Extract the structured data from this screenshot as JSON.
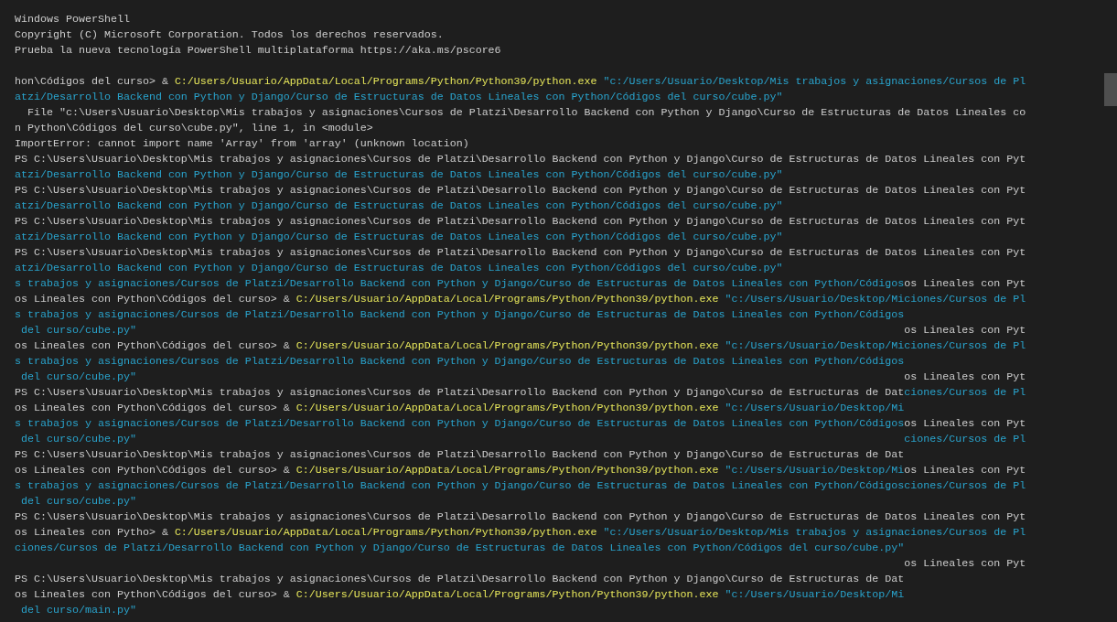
{
  "header": [
    "Windows PowerShell",
    "Copyright (C) Microsoft Corporation. Todos los derechos reservados.",
    "Prueba la nueva tecnología PowerShell multiplataforma https://aka.ms/pscore6"
  ],
  "output": [
    {
      "segments": [
        {
          "kind": "plain",
          "text": "hon\\Códigos del curso> & "
        },
        {
          "kind": "exe",
          "text": "C:/Users/Usuario/AppData/Local/Programs/Python/Python39/python.exe"
        },
        {
          "kind": "string",
          "text": " \"c:/Users/Usuario/Desktop/Mis trabajos y asignaciones/Cursos de Pl"
        }
      ]
    },
    {
      "segments": [
        {
          "kind": "string",
          "text": "atzi/Desarrollo Backend con Python y Django/Curso de Estructuras de Datos Lineales con Python/Códigos del curso/cube.py\""
        }
      ]
    },
    {
      "segments": [
        {
          "kind": "plain",
          "text": "  File \"c:\\Users\\Usuario\\Desktop\\Mis trabajos y asignaciones\\Cursos de Platzi\\Desarrollo Backend con Python y Django\\Curso de Estructuras de Datos Lineales co"
        }
      ]
    },
    {
      "segments": [
        {
          "kind": "plain",
          "text": "n Python\\Códigos del curso\\cube.py\", line 1, in <module>"
        }
      ]
    },
    {
      "segments": [
        {
          "kind": "plain",
          "text": "ImportError: cannot import name 'Array' from 'array' (unknown location)"
        }
      ]
    },
    {
      "segments": [
        {
          "kind": "plain",
          "text": "PS C:\\Users\\Usuario\\Desktop\\Mis trabajos y asignaciones\\Cursos de Platzi\\Desarrollo Backend con Python y Django\\Curso de Estructuras de Datos Lineales con Pyt"
        }
      ]
    },
    {
      "segments": [
        {
          "kind": "string",
          "text": "atzi/Desarrollo Backend con Python y Django/Curso de Estructuras de Datos Lineales con Python/Códigos del curso/cube.py\""
        }
      ]
    },
    {
      "segments": [
        {
          "kind": "plain",
          "text": "PS C:\\Users\\Usuario\\Desktop\\Mis trabajos y asignaciones\\Cursos de Platzi\\Desarrollo Backend con Python y Django\\Curso de Estructuras de Datos Lineales con Pyt"
        }
      ]
    },
    {
      "segments": [
        {
          "kind": "string",
          "text": "atzi/Desarrollo Backend con Python y Django/Curso de Estructuras de Datos Lineales con Python/Códigos del curso/cube.py\""
        }
      ]
    },
    {
      "segments": [
        {
          "kind": "plain",
          "text": "PS C:\\Users\\Usuario\\Desktop\\Mis trabajos y asignaciones\\Cursos de Platzi\\Desarrollo Backend con Python y Django\\Curso de Estructuras de Datos Lineales con Pyt"
        }
      ]
    },
    {
      "segments": [
        {
          "kind": "string",
          "text": "atzi/Desarrollo Backend con Python y Django/Curso de Estructuras de Datos Lineales con Python/Códigos del curso/cube.py\""
        }
      ]
    },
    {
      "segments": [
        {
          "kind": "plain",
          "text": "PS C:\\Users\\Usuario\\Desktop\\Mis trabajos y asignaciones\\Cursos de Platzi\\Desarrollo Backend con Python y Django\\Curso de Estructuras de Datos Lineales con Pyt"
        }
      ]
    },
    {
      "segments": [
        {
          "kind": "string",
          "text": "atzi/Desarrollo Backend con Python y Django/Curso de Estructuras de Datos Lineales con Python/Códigos del curso/cube.py\""
        }
      ]
    },
    {
      "segments": [
        {
          "kind": "string",
          "text": "s trabajos y asignaciones/Cursos de Platzi/Desarrollo Backend con Python y Django/Curso de Estructuras de Datos Lineales con Python/Códigos"
        },
        {
          "kind": "plain",
          "text": "os Lineales con Pyt"
        }
      ]
    },
    {
      "segments": [
        {
          "kind": "plain",
          "text": "os Lineales con Python\\Códigos del curso> & "
        },
        {
          "kind": "exe",
          "text": "C:/Users/Usuario/AppData/Local/Programs/Python/Python39/python.exe"
        },
        {
          "kind": "string",
          "text": " \"c:/Users/Usuario/Desktop/Miciones/Cursos de Pl"
        }
      ]
    },
    {
      "segments": [
        {
          "kind": "string",
          "text": "s trabajos y asignaciones/Cursos de Platzi/Desarrollo Backend con Python y Django/Curso de Estructuras de Datos Lineales con Python/Códigos"
        }
      ]
    },
    {
      "segments": [
        {
          "kind": "string",
          "text": " del curso/cube.py\""
        }
      ],
      "right": [
        {
          "kind": "plain",
          "text": "os Lineales con Pyt"
        }
      ]
    },
    {
      "segments": [
        {
          "kind": "plain",
          "text": "os Lineales con Python\\Códigos del curso> & "
        },
        {
          "kind": "exe",
          "text": "C:/Users/Usuario/AppData/Local/Programs/Python/Python39/python.exe"
        },
        {
          "kind": "string",
          "text": " \"c:/Users/Usuario/Desktop/Miciones/Cursos de Pl"
        }
      ]
    },
    {
      "segments": [
        {
          "kind": "string",
          "text": "s trabajos y asignaciones/Cursos de Platzi/Desarrollo Backend con Python y Django/Curso de Estructuras de Datos Lineales con Python/Códigos"
        }
      ]
    },
    {
      "segments": [
        {
          "kind": "string",
          "text": " del curso/cube.py\""
        }
      ],
      "right": [
        {
          "kind": "plain",
          "text": "os Lineales con Pyt"
        }
      ]
    },
    {
      "segments": [
        {
          "kind": "plain",
          "text": "PS C:\\Users\\Usuario\\Desktop\\Mis trabajos y asignaciones\\Cursos de Platzi\\Desarrollo Backend con Python y Django\\Curso de Estructuras de Dat"
        },
        {
          "kind": "string",
          "text": "ciones/Cursos de Pl"
        }
      ]
    },
    {
      "segments": [
        {
          "kind": "plain",
          "text": "os Lineales con Python\\Códigos del curso> & "
        },
        {
          "kind": "exe",
          "text": "C:/Users/Usuario/AppData/Local/Programs/Python/Python39/python.exe"
        },
        {
          "kind": "string",
          "text": " \"c:/Users/Usuario/Desktop/Mi"
        }
      ]
    },
    {
      "segments": [
        {
          "kind": "string",
          "text": "s trabajos y asignaciones/Cursos de Platzi/Desarrollo Backend con Python y Django/Curso de Estructuras de Datos Lineales con Python/Códigos"
        },
        {
          "kind": "plain",
          "text": "os Lineales con Pyt"
        }
      ]
    },
    {
      "segments": [
        {
          "kind": "string",
          "text": " del curso/cube.py\""
        }
      ],
      "right": [
        {
          "kind": "string",
          "text": "ciones/Cursos de Pl"
        }
      ]
    },
    {
      "segments": [
        {
          "kind": "plain",
          "text": "PS C:\\Users\\Usuario\\Desktop\\Mis trabajos y asignaciones\\Cursos de Platzi\\Desarrollo Backend con Python y Django\\Curso de Estructuras de Dat"
        }
      ]
    },
    {
      "segments": [
        {
          "kind": "plain",
          "text": "os Lineales con Python\\Códigos del curso> & "
        },
        {
          "kind": "exe",
          "text": "C:/Users/Usuario/AppData/Local/Programs/Python/Python39/python.exe"
        },
        {
          "kind": "string",
          "text": " \"c:/Users/Usuario/Desktop/Mi"
        },
        {
          "kind": "plain",
          "text": "os Lineales con Pyt"
        }
      ]
    },
    {
      "segments": [
        {
          "kind": "string",
          "text": "s trabajos y asignaciones/Cursos de Platzi/Desarrollo Backend con Python y Django/Curso de Estructuras de Datos Lineales con Python/Códigosciones/Cursos de Pl"
        }
      ]
    },
    {
      "segments": [
        {
          "kind": "string",
          "text": " del curso/cube.py\""
        }
      ]
    },
    {
      "segments": [
        {
          "kind": "plain",
          "text": "PS C:\\Users\\Usuario\\Desktop\\Mis trabajos y asignaciones\\Cursos de Platzi\\Desarrollo Backend con Python y Django\\Curso de Estructuras de Datos Lineales con Pyt"
        }
      ]
    },
    {
      "segments": [
        {
          "kind": "plain",
          "text": "os Lineales con Pytho> & "
        },
        {
          "kind": "exe",
          "text": "C:/Users/Usuario/AppData/Local/Programs/Python/Python39/python.exe"
        },
        {
          "kind": "string",
          "text": " \"c:/Users/Usuario/Desktop/Mis trabajos y asignaciones/Cursos de Pl"
        }
      ]
    },
    {
      "segments": [
        {
          "kind": "string",
          "text": "ciones/Cursos de Platzi/Desarrollo Backend con Python y Django/Curso de Estructuras de Datos Lineales con Python/Códigos del curso/cube.py\""
        }
      ]
    },
    {
      "right": [
        {
          "kind": "plain",
          "text": "os Lineales con Pyt"
        }
      ]
    },
    {
      "segments": [
        {
          "kind": "plain",
          "text": "PS C:\\Users\\Usuario\\Desktop\\Mis trabajos y asignaciones\\Cursos de Platzi\\Desarrollo Backend con Python y Django\\Curso de Estructuras de Dat"
        }
      ]
    },
    {
      "segments": [
        {
          "kind": "plain",
          "text": "os Lineales con Python\\Códigos del curso> & "
        },
        {
          "kind": "exe",
          "text": "C:/Users/Usuario/AppData/Local/Programs/Python/Python39/python.exe"
        },
        {
          "kind": "string",
          "text": " \"c:/Users/Usuario/Desktop/Mi"
        }
      ]
    },
    {
      "segments": [
        {
          "kind": "string",
          "text": " del curso/main.py\""
        }
      ]
    }
  ]
}
